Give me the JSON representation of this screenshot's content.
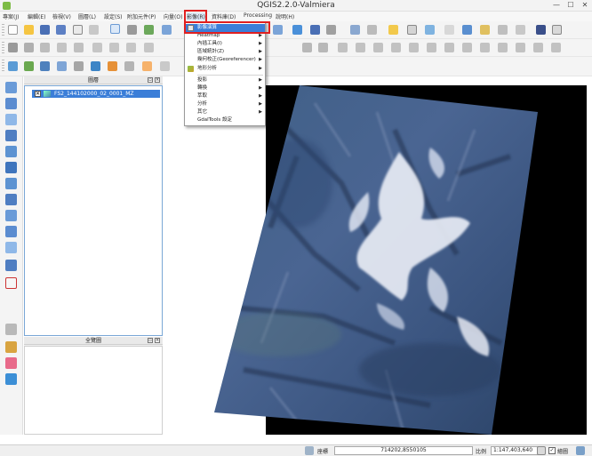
{
  "window": {
    "title": "QGIS2.2.0-Valmiera",
    "minimize": "—",
    "maximize": "☐",
    "close": "✕"
  },
  "menubar": [
    {
      "label": "專案(J)"
    },
    {
      "label": "編輯(E)"
    },
    {
      "label": "檢視(V)"
    },
    {
      "label": "圖層(L)"
    },
    {
      "label": "設定(S)"
    },
    {
      "label": "附加元件(P)"
    },
    {
      "label": "向量(O)"
    },
    {
      "label": "影像(R)"
    },
    {
      "label": "資料庫(D)"
    },
    {
      "label": "Processing"
    },
    {
      "label": "說明(H)"
    }
  ],
  "raster_menu": {
    "items": [
      {
        "label": "影像演算",
        "submenu": false,
        "highlighted": true
      },
      {
        "label": "Heatmap",
        "submenu": true
      },
      {
        "label": "內插工具(I)",
        "submenu": true
      },
      {
        "label": "區域統計(Z)",
        "submenu": true
      },
      {
        "label": "幾何校正(Georeferencer)",
        "submenu": true
      },
      {
        "label": "地形分析",
        "submenu": true
      },
      {
        "label": "投影",
        "submenu": true
      },
      {
        "label": "轉換",
        "submenu": true
      },
      {
        "label": "萃取",
        "submenu": true
      },
      {
        "label": "分析",
        "submenu": true
      },
      {
        "label": "其它",
        "submenu": true
      },
      {
        "label": "GdalTools 設定",
        "submenu": false
      }
    ]
  },
  "layers_panel": {
    "title": "圖層",
    "layer": {
      "name": "FS2_144102000_02_0001_MZ",
      "checked": true
    }
  },
  "overview_panel": {
    "title": "全覽圖"
  },
  "statusbar": {
    "coord_label": "座標",
    "coordinates": "714202,8550105",
    "scale_label": "比例",
    "scale": "1:147,403,640",
    "render_label": "繪圖"
  },
  "colors": {
    "highlight": "#3b7ed8",
    "annotation": "#e02020",
    "map_background": "#000000"
  }
}
